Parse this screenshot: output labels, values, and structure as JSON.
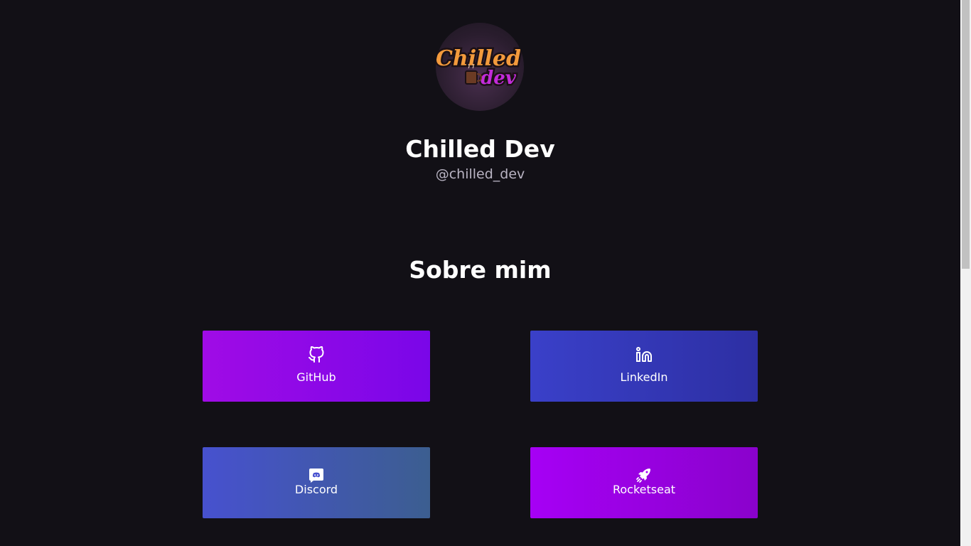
{
  "profile": {
    "name": "Chilled Dev",
    "handle": "@chilled_dev",
    "logo_text_top": "Chilled",
    "logo_text_bottom": "dev"
  },
  "about": {
    "title": "Sobre mim"
  },
  "links": [
    {
      "label": "GitHub",
      "icon": "github-icon",
      "color_start": "#a00be6",
      "color_end": "#7a06e8"
    },
    {
      "label": "LinkedIn",
      "icon": "linkedin-icon",
      "color_start": "#3a40c9",
      "color_end": "#2d2fa3"
    },
    {
      "label": "Discord",
      "icon": "discord-icon",
      "color_start": "#4751cf",
      "color_end": "#3c5e90"
    },
    {
      "label": "Rocketseat",
      "icon": "rocket-icon",
      "color_start": "#a600f5",
      "color_end": "#8a02cc"
    }
  ],
  "colors": {
    "background": "#121016",
    "text": "#ffffff",
    "muted_text": "#b8b3c2"
  }
}
